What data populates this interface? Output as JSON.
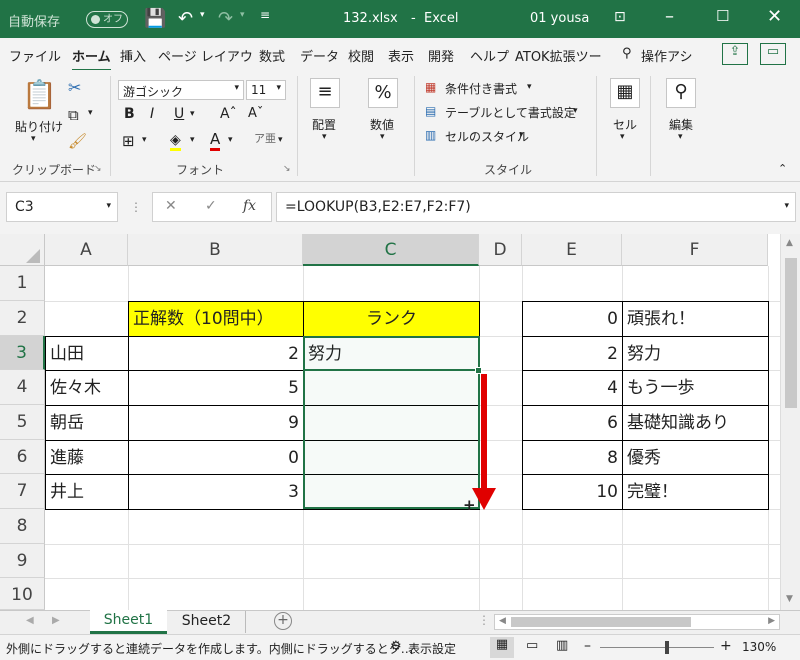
{
  "titlebar": {
    "autosave": "自動保存",
    "toggle": "オフ",
    "filename": "132.xlsx",
    "sep": "-",
    "app": "Excel",
    "user": "01 yousa"
  },
  "tabs": [
    "ファイル",
    "ホーム",
    "挿入",
    "ページ レイアウト",
    "数式",
    "データ",
    "校閲",
    "表示",
    "開発",
    "ヘルプ",
    "ATOK拡張ツー"
  ],
  "tell_me": "操作アシ",
  "ribbon": {
    "paste": "貼り付け",
    "clipboard": "クリップボード",
    "font_name": "游ゴシック",
    "font_size": "11",
    "font": "フォント",
    "align": "配置",
    "number": "数値",
    "cond_format": "条件付き書式",
    "table_format": "テーブルとして書式設定",
    "cell_style": "セルのスタイル",
    "style": "スタイル",
    "cells": "セル",
    "edit": "編集"
  },
  "formula": {
    "namebox": "C3",
    "fx": "fx",
    "value": "=LOOKUP(B3,E2:E7,F2:F7)"
  },
  "columns": [
    "A",
    "B",
    "C",
    "D",
    "E",
    "F"
  ],
  "rows": [
    "1",
    "2",
    "3",
    "4",
    "5",
    "6",
    "7",
    "8",
    "9",
    "10"
  ],
  "table": {
    "header_b": "正解数（10問中）",
    "header_c": "ランク",
    "names": [
      "山田",
      "佐々木",
      "朝岳",
      "進藤",
      "井上"
    ],
    "scores": [
      "2",
      "5",
      "9",
      "0",
      "3"
    ],
    "c3": "努力"
  },
  "lookup": {
    "e": [
      "0",
      "2",
      "4",
      "6",
      "8",
      "10"
    ],
    "f": [
      "頑張れ！",
      "努力",
      "もう一歩",
      "基礎知識あり",
      "優秀",
      "完璧！"
    ]
  },
  "sheets": [
    "Sheet1",
    "Sheet2"
  ],
  "status": {
    "message": "外側にドラッグすると連続データを作成します。内側にドラッグするとク…",
    "display": "表示設定",
    "zoom": "130%"
  },
  "colors": {
    "accent": "#217346",
    "highlight": "#ffff00",
    "arrow": "#e00000"
  }
}
